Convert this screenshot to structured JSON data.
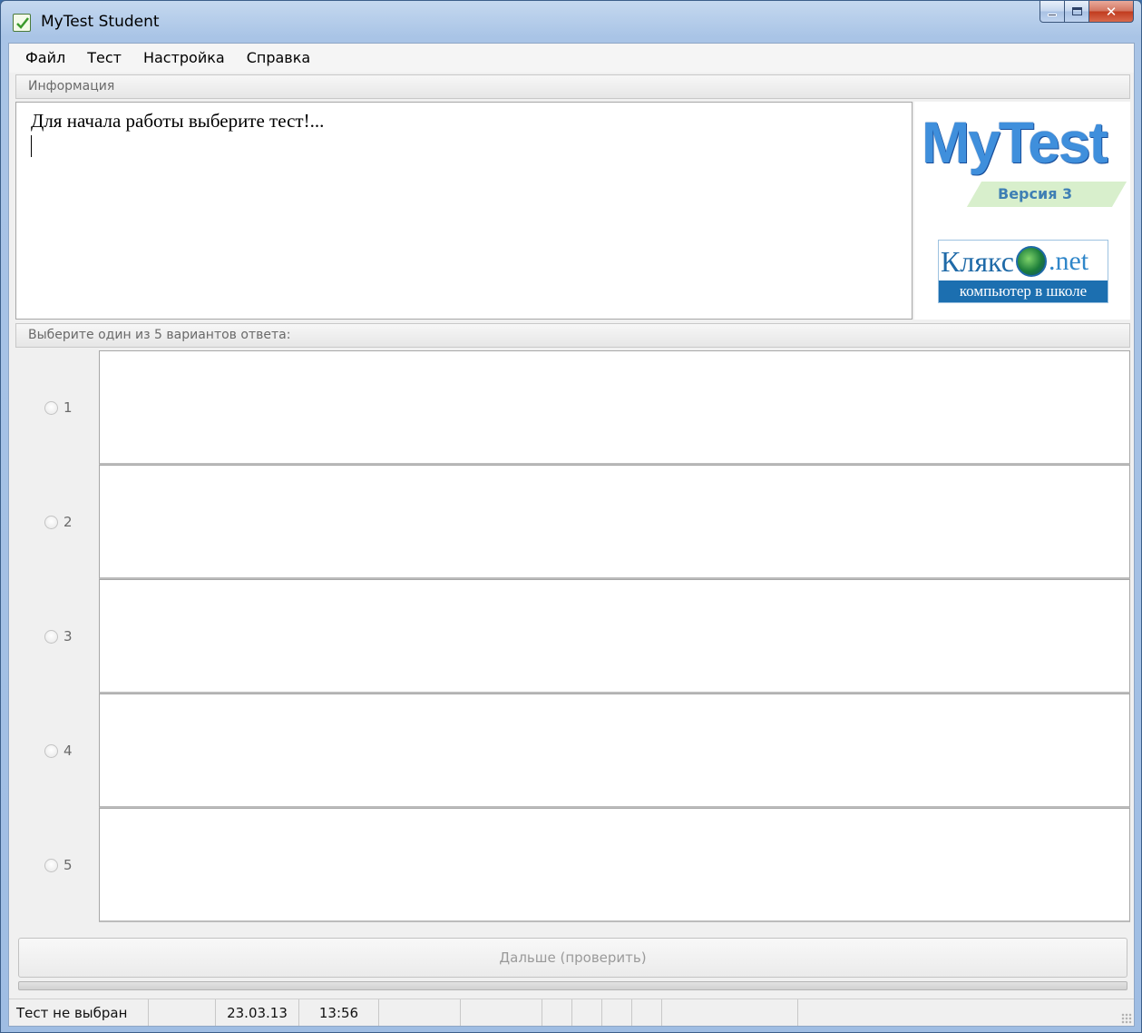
{
  "window": {
    "title": "MyTest Student"
  },
  "menu": {
    "items": [
      "Файл",
      "Тест",
      "Настройка",
      "Справка"
    ]
  },
  "info": {
    "header": "Информация",
    "message": "Для начала работы выберите тест!..."
  },
  "logo": {
    "title": "MyTest",
    "version": "Версия 3",
    "partner_main": "Клякс",
    "partner_suffix": ".net",
    "partner_tagline": "компьютер в школе"
  },
  "answers": {
    "header": "Выберите один из 5 вариантов ответа:",
    "options": [
      {
        "label": "1",
        "text": ""
      },
      {
        "label": "2",
        "text": ""
      },
      {
        "label": "3",
        "text": ""
      },
      {
        "label": "4",
        "text": ""
      },
      {
        "label": "5",
        "text": ""
      }
    ]
  },
  "actions": {
    "next_label": "Дальше (проверить)"
  },
  "status": {
    "test": "Тест не выбран",
    "date": "23.03.13",
    "time": "13:56"
  },
  "colors": {
    "logo_blue": "#3f8fdc",
    "partner_blue": "#1c6fb0",
    "version_green": "#d8efcc"
  }
}
